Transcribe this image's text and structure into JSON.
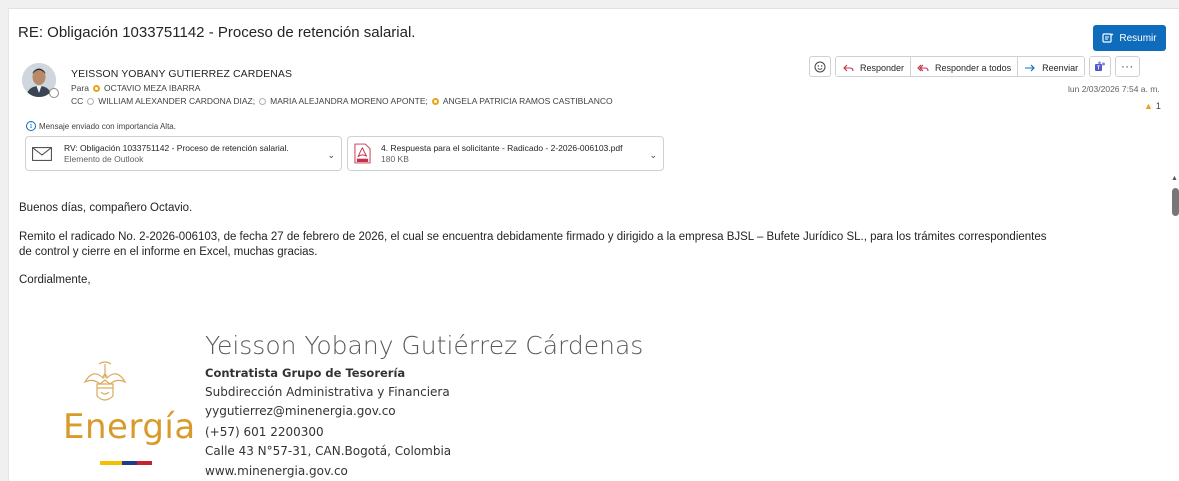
{
  "email": {
    "subject": "RE: Obligación 1033751142 - Proceso de retención salarial.",
    "summarize_label": "Resumir",
    "sender": "YEISSON YOBANY GUTIERREZ CARDENAS",
    "to_label": "Para",
    "to": "OCTAVIO MEZA IBARRA",
    "cc_label": "CC",
    "cc": [
      "WILLIAM ALEXANDER CARDONA DIAZ;",
      "MARIA ALEJANDRA MORENO APONTE;",
      "ANGELA PATRICIA RAMOS CASTIBLANCO"
    ],
    "date": "lun 2/03/2026 7:54 a. m.",
    "reaction_count": "1",
    "importance": "Mensaje enviado con importancia Alta."
  },
  "actions": {
    "reply": "Responder",
    "reply_all": "Responder a todos",
    "forward": "Reenviar"
  },
  "attachments": [
    {
      "title": "RV: Obligación 1033751142 - Proceso de retención salarial.",
      "subtitle": "Elemento de Outlook",
      "icon": "mail-icon"
    },
    {
      "title": "4. Respuesta para el solicitante - Radicado - 2-2026-006103.pdf",
      "subtitle": "180 KB",
      "icon": "pdf-icon"
    }
  ],
  "body": {
    "greeting": "Buenos días, compañero Octavio.",
    "paragraph_1": "Remito el radicado No. 2-2026-006103, de fecha 27 de febrero de 2026, el cual se encuentra debidamente firmado y dirigido a la empresa BJSL – Bufete Jurídico SL., para los trámites correspondientes",
    "paragraph_2": "de control y cierre en el informe en Excel, muchas gracias.",
    "closing": "Cordialmente,"
  },
  "signature": {
    "name": "Yeisson Yobany Gutiérrez Cárdenas",
    "role": "Contratista Grupo de Tesorería",
    "department": "Subdirección Administrativa y Financiera",
    "email": "yygutierrez@minenergia.gov.co",
    "phone": "(+57) 601 2200300",
    "address": "Calle 43 N°57-31, CAN.Bogotá, Colombia",
    "website": "www.minenergia.gov.co",
    "logo_text": "Energía"
  },
  "colors": {
    "accent": "#0f6cbd",
    "energia_gold": "#d99a2b",
    "flag_yellow": "#f2c200",
    "flag_blue": "#1f3c8c",
    "flag_red": "#c8202f"
  }
}
